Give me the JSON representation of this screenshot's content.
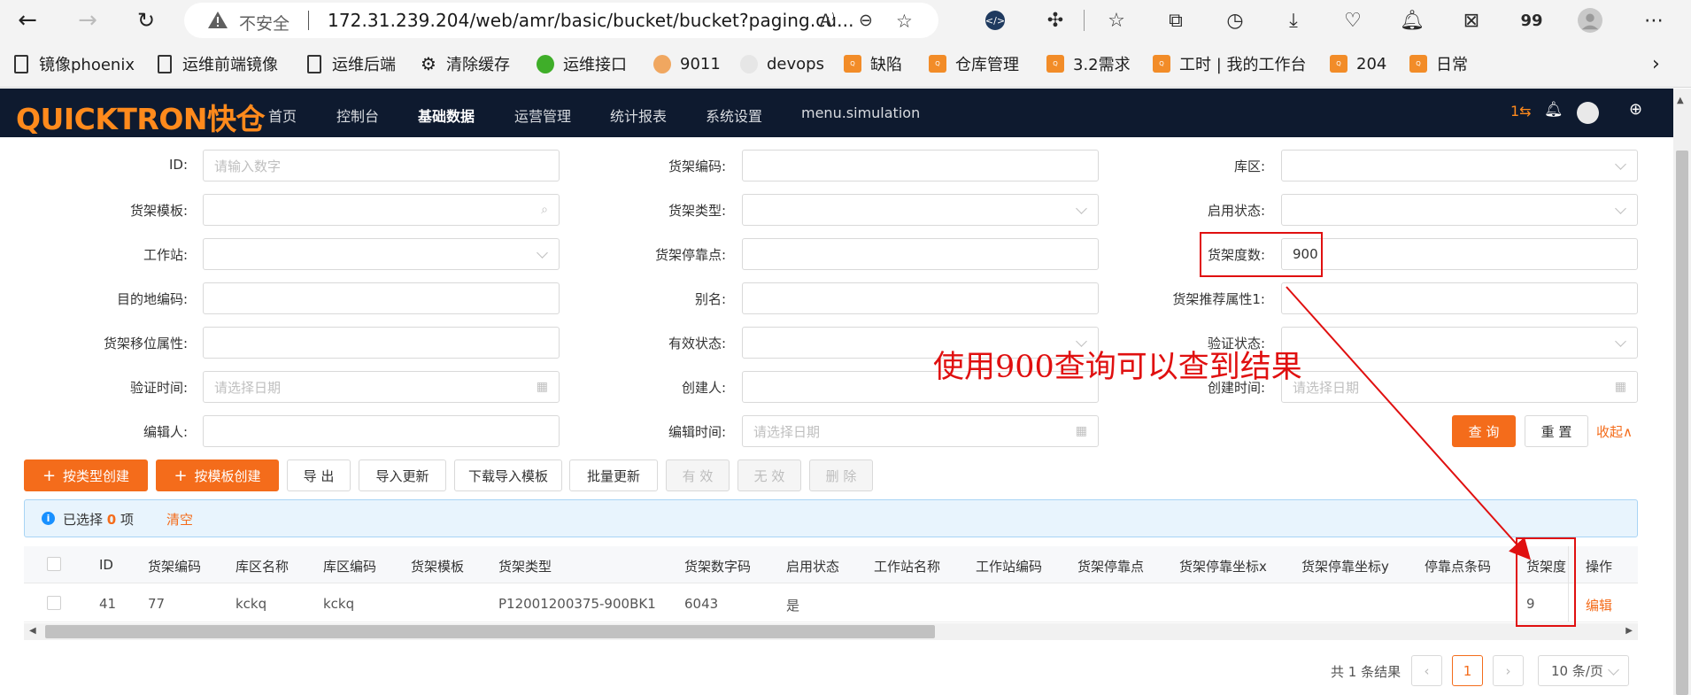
{
  "browser": {
    "insecure_label": "不安全",
    "url": "172.31.239.204/web/amr/basic/bucket/bucket?paging.cu...",
    "ext_count": "99",
    "bookmarks": [
      {
        "label": "镜像phoenix"
      },
      {
        "label": "运维前端镜像"
      },
      {
        "label": "运维后端"
      },
      {
        "label": "清除缓存"
      },
      {
        "label": "运维接口"
      },
      {
        "label": "9011"
      },
      {
        "label": "devops"
      },
      {
        "label": "缺陷"
      },
      {
        "label": "仓库管理"
      },
      {
        "label": "3.2需求"
      },
      {
        "label": "工时 | 我的工作台"
      },
      {
        "label": "204"
      },
      {
        "label": "日常"
      }
    ]
  },
  "app": {
    "logo": "QUICKTRON快仓",
    "menu": [
      "首页",
      "控制台",
      "基础数据",
      "运营管理",
      "统计报表",
      "系统设置",
      "menu.simulation"
    ],
    "header_count": "1⇆"
  },
  "form": {
    "fields": [
      {
        "label": "ID:",
        "placeholder": "请输入数字",
        "value": ""
      },
      {
        "label": "货架编码:",
        "placeholder": "",
        "value": ""
      },
      {
        "label": "库区:",
        "placeholder": "",
        "value": ""
      },
      {
        "label": "货架模板:",
        "placeholder": "",
        "value": ""
      },
      {
        "label": "货架类型:",
        "placeholder": "",
        "value": ""
      },
      {
        "label": "启用状态:",
        "placeholder": "",
        "value": ""
      },
      {
        "label": "工作站:",
        "placeholder": "",
        "value": ""
      },
      {
        "label": "货架停靠点:",
        "placeholder": "",
        "value": ""
      },
      {
        "label": "货架度数:",
        "placeholder": "",
        "value": "900"
      },
      {
        "label": "目的地编码:",
        "placeholder": "",
        "value": ""
      },
      {
        "label": "别名:",
        "placeholder": "",
        "value": ""
      },
      {
        "label": "货架推荐属性1:",
        "placeholder": "",
        "value": ""
      },
      {
        "label": "货架移位属性:",
        "placeholder": "",
        "value": ""
      },
      {
        "label": "有效状态:",
        "placeholder": "",
        "value": ""
      },
      {
        "label": "验证状态:",
        "placeholder": "",
        "value": ""
      },
      {
        "label": "验证时间:",
        "placeholder": "请选择日期",
        "value": ""
      },
      {
        "label": "创建人:",
        "placeholder": "",
        "value": ""
      },
      {
        "label": "创建时间:",
        "placeholder": "请选择日期",
        "value": ""
      },
      {
        "label": "编辑人:",
        "placeholder": "",
        "value": ""
      },
      {
        "label": "编辑时间:",
        "placeholder": "请选择日期",
        "value": ""
      }
    ],
    "query_label": "查 询",
    "reset_label": "重 置",
    "collapse_label": "收起∧"
  },
  "toolbar": {
    "create_by_type": "按类型创建",
    "create_by_template": "按模板创建",
    "export": "导 出",
    "import_update": "导入更新",
    "download_template": "下载导入模板",
    "batch_update": "批量更新",
    "valid": "有 效",
    "invalid": "无 效",
    "delete": "删 除"
  },
  "selection": {
    "prefix": "已选择",
    "count": "0",
    "suffix": "项",
    "clear": "清空"
  },
  "table": {
    "columns": [
      "ID",
      "货架编码",
      "库区名称",
      "库区编码",
      "货架模板",
      "货架类型",
      "货架数字码",
      "启用状态",
      "工作站名称",
      "工作站编码",
      "货架停靠点",
      "货架停靠坐标x",
      "货架停靠坐标y",
      "停靠点条码",
      "货架度",
      "操作"
    ],
    "rows": [
      {
        "id": "41",
        "code": "77",
        "zone_name": "kckq",
        "zone_code": "kckq",
        "type": "P12001200375-900BK1",
        "digit_code": "6043",
        "enabled": "是",
        "degree": "9",
        "action": "编辑"
      }
    ]
  },
  "pagination": {
    "total": "共 1 条结果",
    "current": "1",
    "page_size": "10 条/页"
  },
  "annotation": {
    "text": "使用900查询可以查到结果"
  }
}
